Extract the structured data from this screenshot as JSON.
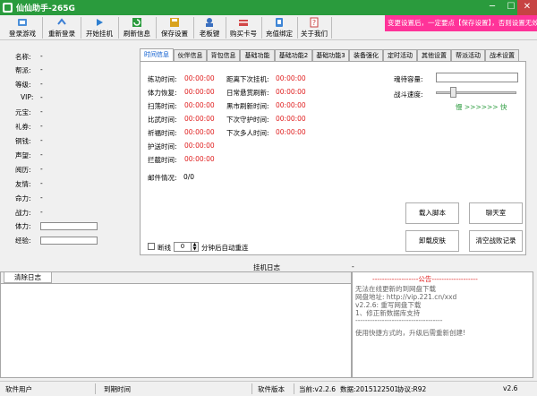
{
  "window": {
    "title": "仙仙助手-265G",
    "min": "─",
    "max": "☐",
    "close": "✕"
  },
  "toolbar": {
    "items": [
      {
        "label": "登录游戏",
        "icon": "login-game-icon",
        "color": "#4a8fd9"
      },
      {
        "label": "重新登录",
        "icon": "relogin-icon",
        "color": "#3b7ed4"
      },
      {
        "label": "开始挂机",
        "icon": "start-icon",
        "color": "#2e7fd0"
      },
      {
        "label": "刷新信息",
        "icon": "refresh-icon",
        "color": "#2a9b3d"
      },
      {
        "label": "保存设置",
        "icon": "save-icon",
        "color": "#d9a21d"
      },
      {
        "label": "老板键",
        "icon": "boss-key-icon",
        "color": "#3a6fbf"
      },
      {
        "label": "购买卡号",
        "icon": "buy-card-icon",
        "color": "#d24848"
      },
      {
        "label": "充值绑定",
        "icon": "recharge-bind-icon",
        "color": "#3f86d6"
      },
      {
        "label": "关于我们",
        "icon": "about-icon",
        "color": "#c94040"
      }
    ],
    "notice": "变更设置后，一定要点【保存设置】，否则设置无效！"
  },
  "left_panel": {
    "rows": [
      {
        "label": "名称:",
        "value": "-"
      },
      {
        "label": "帮派:",
        "value": "-"
      },
      {
        "label": "等级:",
        "value": "-"
      },
      {
        "label": "VIP:",
        "value": "-"
      },
      {
        "label": "元宝:",
        "value": "-"
      },
      {
        "label": "礼券:",
        "value": "-"
      },
      {
        "label": "铜钱:",
        "value": "-"
      },
      {
        "label": "声望:",
        "value": "-"
      },
      {
        "label": "阅历:",
        "value": "-"
      },
      {
        "label": "友情:",
        "value": "-"
      },
      {
        "label": "命力:",
        "value": "-"
      },
      {
        "label": "战力:",
        "value": "-"
      }
    ],
    "stamina_label": "体力:",
    "exp_label": "经验:"
  },
  "tabs": [
    "时间信息",
    "伙伴信息",
    "背包信息",
    "基础功能",
    "基础功能2",
    "基础功能3",
    "装备强化",
    "定时活动",
    "其他设置",
    "帮派活动",
    "战术设置"
  ],
  "time_info": {
    "left": [
      {
        "label": "练功时间:",
        "value": "00:00:00"
      },
      {
        "label": "体力恢复:",
        "value": "00:00:00"
      },
      {
        "label": "扫荡时间:",
        "value": "00:00:00"
      },
      {
        "label": "比武时间:",
        "value": "00:00:00"
      },
      {
        "label": "祈福时间:",
        "value": "00:00:00"
      },
      {
        "label": "护送时间:",
        "value": "00:00:00"
      },
      {
        "label": "拦截时间:",
        "value": "00:00:00"
      }
    ],
    "right": [
      {
        "label": "距离下次挂机:",
        "value": "00:00:00"
      },
      {
        "label": "日常悬赏刷新:",
        "value": "00:00:00"
      },
      {
        "label": "黑市刷新时间:",
        "value": "00:00:00"
      },
      {
        "label": "下次守护时间:",
        "value": "00:00:00"
      },
      {
        "label": "下次多人时间:",
        "value": "00:00:00"
      }
    ],
    "mail_label": "邮件情况:",
    "mail_value": "0/0",
    "soul_capacity_label": "魂待容量:",
    "battle_speed_label": "战斗速度:",
    "speed_slow": "慢",
    "speed_arrows": ">>>>>>",
    "speed_fast": "快",
    "buttons": {
      "load_script": "载入脚本",
      "chat_room": "聊天室",
      "unload_skin": "卸载皮肤",
      "clear_battle_log": "清空战败记录"
    },
    "disconnect_label": "断线",
    "disconnect_value": "0",
    "reconnect_suffix": "分钟后自动重连"
  },
  "log": {
    "title": "挂机日志",
    "clear_button": "清除日志",
    "dash": "-"
  },
  "announcement": {
    "title": "-------------------公告-------------------",
    "lines": [
      "无法在线更新的到网盘下载",
      "网盘地址: http://vip.221.cn/xxd",
      "v2.2.6: 重写网盘下载",
      "1、修正新数据库支持",
      "------------------------------------",
      "使用快捷方式的，升级后需重新创建!"
    ]
  },
  "status": {
    "user_label": "软件用户",
    "expiry_label": "到期时间",
    "version_label": "软件版本",
    "current_version": "当前:v2.2.6",
    "data_version": "数据:2015122501",
    "protocol_version": "协议:R92",
    "tail": "v2.6"
  }
}
